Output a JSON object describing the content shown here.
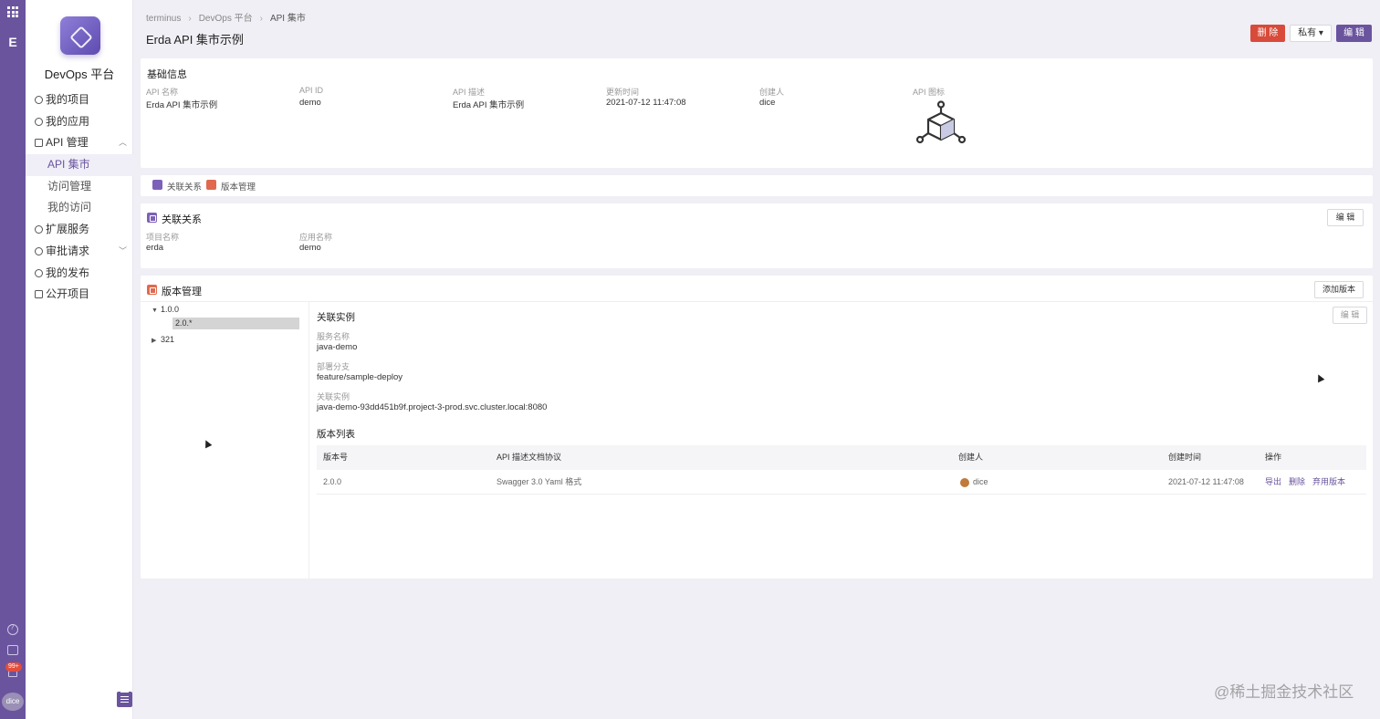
{
  "rail": {
    "notification_badge": "99+",
    "user_label": "dice",
    "user_color": "#9a8fb5"
  },
  "sidebar": {
    "title": "DevOps 平台",
    "items": [
      {
        "label": "我的项目",
        "icon": "project-icon"
      },
      {
        "label": "我的应用",
        "icon": "app-icon"
      },
      {
        "label": "API 管理",
        "icon": "api-icon"
      },
      {
        "label": "API 集市",
        "icon": ""
      },
      {
        "label": "访问管理",
        "icon": ""
      },
      {
        "label": "我的访问",
        "icon": ""
      },
      {
        "label": "扩展服务",
        "icon": "addon-icon"
      },
      {
        "label": "审批请求",
        "icon": "approval-icon"
      },
      {
        "label": "我的发布",
        "icon": "publish-icon"
      },
      {
        "label": "公开项目",
        "icon": "public-project-icon"
      }
    ]
  },
  "breadcrumb": [
    "terminus",
    "DevOps 平台",
    "API 集市"
  ],
  "page": {
    "title": "Erda API 集市示例",
    "delete_label": "删 除",
    "privacy_label": "私有",
    "edit_label": "编 辑"
  },
  "basic": {
    "title": "基础信息",
    "fields": [
      {
        "label": "API 名称",
        "value": "Erda API 集市示例"
      },
      {
        "label": "API ID",
        "value": "demo"
      },
      {
        "label": "API 描述",
        "value": "Erda API 集市示例"
      },
      {
        "label": "更新时间",
        "value": "2021-07-12 11:47:08"
      },
      {
        "label": "创建人",
        "value": "dice"
      },
      {
        "label": "API 图标",
        "value": ""
      }
    ]
  },
  "anchors": [
    "关联关系",
    "版本管理"
  ],
  "relation": {
    "title": "关联关系",
    "edit_label": "编 辑",
    "fields": [
      {
        "label": "项目名称",
        "value": "erda"
      },
      {
        "label": "应用名称",
        "value": "demo"
      }
    ]
  },
  "versions": {
    "title": "版本管理",
    "add_label": "添加版本",
    "tree": [
      {
        "label": "1.0.0"
      },
      {
        "label": "2.0.*"
      },
      {
        "label": "321"
      }
    ],
    "instance": {
      "title": "关联实例",
      "edit_label": "编 辑",
      "fields": [
        {
          "label": "服务名称",
          "value": "java-demo"
        },
        {
          "label": "部署分支",
          "value": "feature/sample-deploy"
        },
        {
          "label": "关联实例",
          "value": "java-demo-93dd451b9f.project-3-prod.svc.cluster.local:8080"
        }
      ]
    },
    "list_title": "版本列表",
    "columns": [
      "版本号",
      "API 描述文档协议",
      "创建人",
      "创建时间",
      "操作"
    ],
    "rows": [
      {
        "version": "2.0.0",
        "protocol": "Swagger 3.0 Yaml 格式",
        "creator": "dice",
        "created": "2021-07-12 11:47:08",
        "actions": [
          "导出",
          "删除",
          "弃用版本"
        ]
      }
    ]
  },
  "watermark": "@稀土掘金技术社区",
  "colors": {
    "accent": "#6a549e",
    "danger": "#d84a3a"
  }
}
